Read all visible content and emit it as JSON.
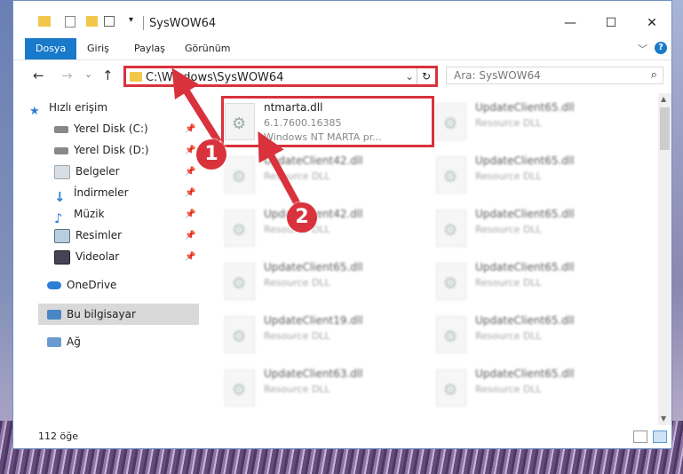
{
  "window": {
    "title": "SysWOW64"
  },
  "controls": {
    "minimize": "—",
    "maximize": "☐",
    "close": "✕"
  },
  "ribbon": {
    "tabs": [
      "Dosya",
      "Giriş",
      "Paylaş",
      "Görünüm"
    ],
    "expand": "﹀",
    "help": "?"
  },
  "nav": {
    "back": "←",
    "forward": "→",
    "history": "⌄",
    "up": "↑",
    "address": "C:\\Windows\\SysWOW64",
    "address_chevron": "⌄",
    "refresh": "↻",
    "search_placeholder": "Ara: SysWOW64",
    "search_icon": "⌕"
  },
  "sidebar": {
    "quick_access": "Hızlı erişim",
    "items": [
      {
        "label": "Yerel Disk (C:)",
        "icon": "drive-icon",
        "pinned": true
      },
      {
        "label": "Yerel Disk (D:)",
        "icon": "drive-icon",
        "pinned": true
      },
      {
        "label": "Belgeler",
        "icon": "documents-icon",
        "pinned": true
      },
      {
        "label": "İndirmeler",
        "icon": "downloads-icon",
        "pinned": true
      },
      {
        "label": "Müzik",
        "icon": "music-icon",
        "pinned": true
      },
      {
        "label": "Resimler",
        "icon": "pictures-icon",
        "pinned": true
      },
      {
        "label": "Videolar",
        "icon": "videos-icon",
        "pinned": true
      }
    ],
    "onedrive": "OneDrive",
    "this_pc": "Bu bilgisayar",
    "network": "Ağ",
    "pin_glyph": "📌"
  },
  "files": {
    "highlighted": {
      "name": "ntmarta.dll",
      "version": "6.1.7600.16385",
      "description": "Windows NT MARTA pr..."
    },
    "left_column": [
      {
        "name": "UpdateClient42.dll",
        "type": "Resource DLL"
      },
      {
        "name": "UpdateClient42.dll",
        "type": "Resource DLL"
      },
      {
        "name": "UpdateClient65.dll",
        "type": "Resource DLL"
      },
      {
        "name": "UpdateClient19.dll",
        "type": "Resource DLL"
      },
      {
        "name": "UpdateClient63.dll",
        "type": "Resource DLL"
      }
    ],
    "right_column": [
      {
        "name": "UpdateClient65.dll",
        "type": "Resource DLL"
      },
      {
        "name": "UpdateClient65.dll",
        "type": "Resource DLL"
      },
      {
        "name": "UpdateClient65.dll",
        "type": "Resource DLL"
      },
      {
        "name": "UpdateClient65.dll",
        "type": "Resource DLL"
      },
      {
        "name": "UpdateClient65.dll",
        "type": "Resource DLL"
      },
      {
        "name": "UpdateClient65.dll",
        "type": "Resource DLL"
      }
    ]
  },
  "status": {
    "count": "112 öğe"
  },
  "annotations": {
    "step1": "1",
    "step2": "2",
    "color": "#d9323c"
  }
}
